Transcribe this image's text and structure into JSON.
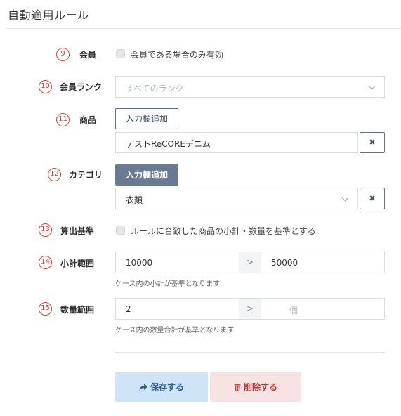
{
  "page_title": "自動適用ルール",
  "rows": {
    "member": {
      "num": "9",
      "label": "会員",
      "checkbox_label": "会員である場合のみ有効",
      "checked": false
    },
    "rank": {
      "num": "10",
      "label": "会員ランク",
      "select_placeholder": "すべてのランク"
    },
    "product": {
      "num": "11",
      "label": "商品",
      "add_button": "入力欄追加",
      "value": "テストReCOREデニム",
      "remove_icon": "x-icon"
    },
    "category": {
      "num": "12",
      "label": "カテゴリ",
      "add_button": "入力欄追加",
      "value": "衣類",
      "remove_icon": "x-icon"
    },
    "basis": {
      "num": "13",
      "label": "算出基準",
      "checkbox_label": "ルールに合致した商品の小計・数量を基準とする",
      "checked": false
    },
    "subtotal": {
      "num": "14",
      "label": "小計範囲",
      "from": "10000",
      "separator": ">",
      "to": "50000",
      "help": "ケース内の小計が基準となります"
    },
    "quantity": {
      "num": "15",
      "label": "数量範囲",
      "from": "2",
      "separator": ">",
      "to_placeholder": "個",
      "help": "ケース内の数量合計が基準となります"
    }
  },
  "actions": {
    "save_label": "保存する",
    "delete_label": "削除する"
  },
  "colors": {
    "marker_red": "#e0403a",
    "navy": "#5c6f8c",
    "save_bg": "#cfe4f6",
    "delete_bg": "#f7e3e3"
  }
}
